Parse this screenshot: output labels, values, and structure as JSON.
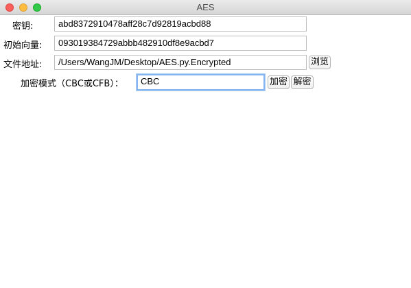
{
  "window": {
    "title": "AES"
  },
  "form": {
    "key_label": "密钥:",
    "key_value": "abd8372910478aff28c7d92819acbd88",
    "iv_label": "初始向量:",
    "iv_value": "093019384729abbb482910df8e9acbd7",
    "path_label": "文件地址:",
    "path_value": "/Users/WangJM/Desktop/AES.py.Encrypted",
    "browse_label": "浏览",
    "mode_label": "加密模式（CBC或CFB）：",
    "mode_value": "CBC",
    "encrypt_label": "加密",
    "decrypt_label": "解密"
  }
}
